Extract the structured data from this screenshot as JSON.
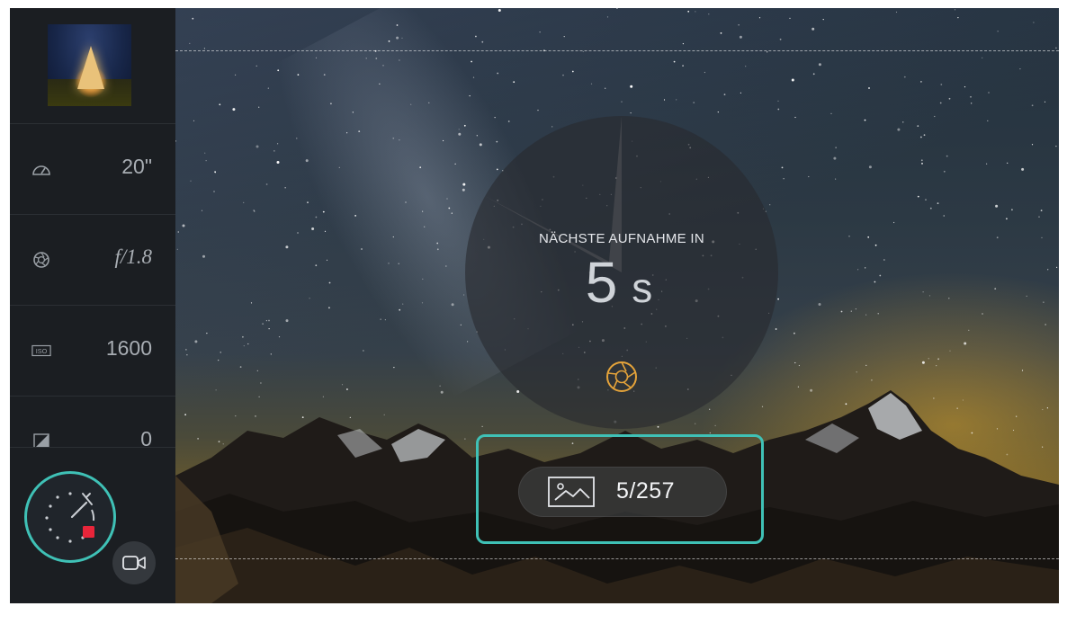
{
  "sidebar": {
    "thumbnail": {
      "icon": "photo-thumbnail"
    },
    "params": [
      {
        "icon": "speedometer-icon",
        "value": "20\""
      },
      {
        "icon": "aperture-icon",
        "value": "f/1.8"
      },
      {
        "icon": "iso-icon",
        "value": "1600"
      },
      {
        "icon": "exposure-compensation-icon",
        "value": "0"
      }
    ],
    "timer_button": {
      "icon": "timer-stop-icon"
    },
    "video_button": {
      "icon": "video-camera-icon"
    }
  },
  "viewport": {
    "countdown": {
      "label": "NÄCHSTE AUFNAHME IN",
      "value": "5",
      "unit": "s"
    },
    "shutter_icon": "shutter-icon",
    "counter": {
      "icon": "image-icon",
      "text": "5/257"
    }
  },
  "colors": {
    "accent": "#3fc1b6",
    "shutter": "#e4a33a",
    "record": "#e8253a",
    "sidebar_bg": "#1b1e22"
  }
}
